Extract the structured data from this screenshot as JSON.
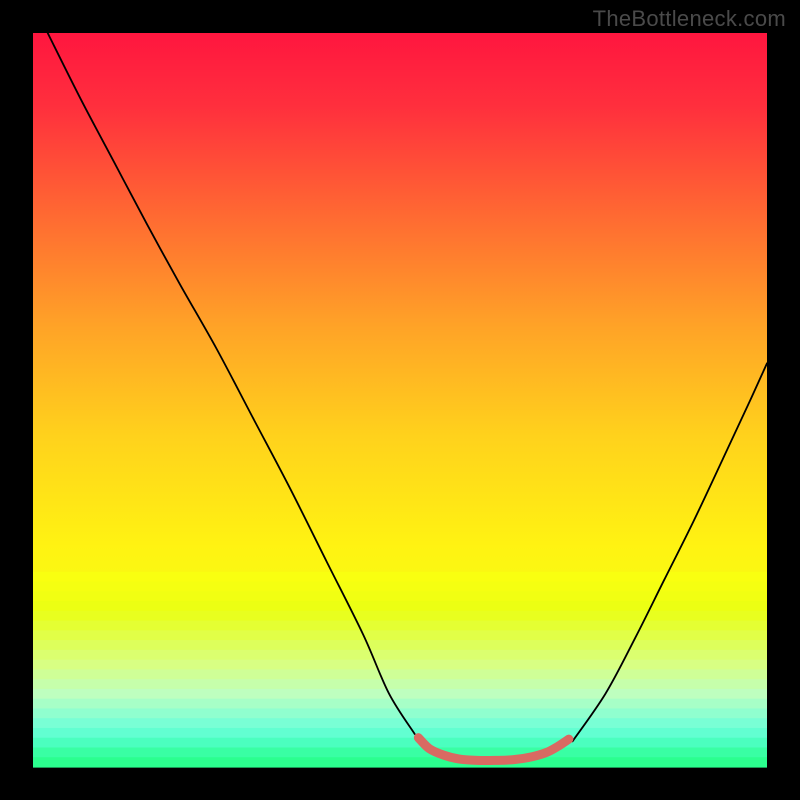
{
  "watermark": "TheBottleneck.com",
  "chart_data": {
    "type": "line",
    "title": "",
    "xlabel": "",
    "ylabel": "",
    "xlim": [
      0,
      100
    ],
    "ylim": [
      0,
      100
    ],
    "grid": false,
    "legend": false,
    "annotations": [],
    "background_gradient": {
      "stops": [
        {
          "offset": 0.0,
          "color": "#ff163f"
        },
        {
          "offset": 0.1,
          "color": "#ff2f3d"
        },
        {
          "offset": 0.25,
          "color": "#ff6a32"
        },
        {
          "offset": 0.4,
          "color": "#ffa327"
        },
        {
          "offset": 0.55,
          "color": "#ffd21c"
        },
        {
          "offset": 0.7,
          "color": "#fff312"
        },
        {
          "offset": 0.8,
          "color": "#f3ff12"
        },
        {
          "offset": 0.86,
          "color": "#e0ff40"
        },
        {
          "offset": 0.92,
          "color": "#bfffb0"
        },
        {
          "offset": 1.0,
          "color": "#2bff8f"
        }
      ]
    },
    "gradient_stripes_bottom": {
      "y_start": 73.4,
      "y_end": 100,
      "colors": [
        "#f9ff10",
        "#f5ff11",
        "#f1ff12",
        "#ecff13",
        "#e8ff1f",
        "#e4ff33",
        "#e1ff47",
        "#ddff5b",
        "#dbff6f",
        "#d8ff83",
        "#cfff97",
        "#c6ffab",
        "#beffbf",
        "#a7ffc7",
        "#90ffcf",
        "#79ffd5",
        "#62ffd1",
        "#4bffbf",
        "#39ffa4",
        "#2bff8f"
      ]
    },
    "series": [
      {
        "name": "bottleneck-curve",
        "color": "#000000",
        "stroke_width": 1.8,
        "x": [
          2.0,
          6.5,
          11.0,
          15.5,
          20.0,
          25.0,
          30.0,
          35.0,
          40.0,
          45.0,
          48.5,
          52.0
        ],
        "values": [
          100.0,
          91.0,
          82.5,
          74.0,
          65.8,
          57.0,
          47.5,
          38.0,
          28.0,
          18.0,
          10.0,
          4.5
        ]
      },
      {
        "name": "bottleneck-curve-right",
        "color": "#000000",
        "stroke_width": 1.8,
        "x": [
          73.5,
          78.0,
          82.0,
          86.0,
          90.0,
          94.0,
          97.5,
          100.0
        ],
        "values": [
          3.5,
          10.0,
          17.5,
          25.5,
          33.5,
          42.0,
          49.5,
          55.0
        ]
      },
      {
        "name": "bottleneck-valley-marker",
        "color": "#d96a62",
        "stroke_width": 9.0,
        "x": [
          52.5,
          54.0,
          56.0,
          58.0,
          60.5,
          63.0,
          65.5,
          68.0,
          70.0,
          71.5,
          73.0
        ],
        "values": [
          4.0,
          2.5,
          1.6,
          1.1,
          0.9,
          0.9,
          1.0,
          1.4,
          2.0,
          2.8,
          3.8
        ]
      }
    ]
  }
}
